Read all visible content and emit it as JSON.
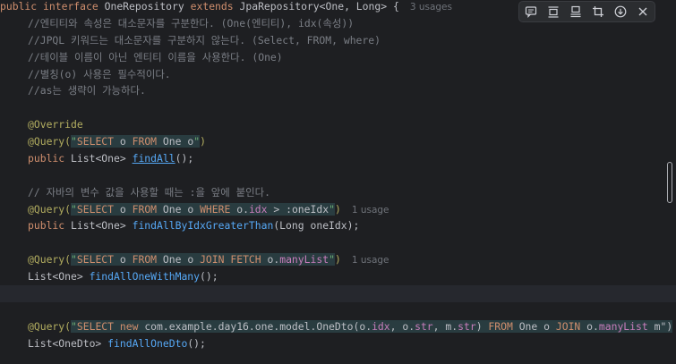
{
  "editor": {
    "header": {
      "public": "public",
      "interface": "interface",
      "name": "OneRepository",
      "extends": "extends",
      "parent": "JpaRepository<One, Long>",
      "brace": " {",
      "usages": "3 usages"
    },
    "comments": [
      "//엔티티와 속성은 대소문자를 구분한다. (One(엔티티), idx(속성))",
      "//JPQL 키워드는 대소문자를 구분하지 않는다. (Select, FROM, where)",
      "//테이블 이름이 아닌 엔티티 이름을 사용한다. (One)",
      "//별칭(o) 사용은 필수적이다.",
      "//as는 생략이 가능하다."
    ],
    "method1": {
      "override": "@Override",
      "query_ann": "@Query(",
      "q_open": "\"",
      "q_select": "SELECT",
      "q_o1": " o ",
      "q_from": "FROM",
      "q_one": " One o",
      "q_close": "\"",
      "paren_close": ")",
      "public": "public",
      "rtype": " List<One> ",
      "name": "findAll",
      "tail": "();"
    },
    "comment2": "// 자바의 변수 값을 사용할 때는 :을 앞에 붙인다.",
    "method2": {
      "query_ann": "@Query(",
      "q_open": "\"",
      "q_select": "SELECT",
      "q_o1": " o ",
      "q_from": "FROM",
      "q_one": " One o ",
      "q_where": "WHERE",
      "q_o2": " o.",
      "q_idx": "idx",
      "q_rest": " > :oneIdx",
      "q_close": "\"",
      "paren_close": ")",
      "usages": "1 usage",
      "public": "public",
      "rtype": " List<One> ",
      "name": "findAllByIdxGreaterThan",
      "tail": "(Long oneIdx);"
    },
    "method3": {
      "query_ann": "@Query(",
      "q_open": "\"",
      "q_select": "SELECT",
      "q_o1": " o ",
      "q_from": "FROM",
      "q_one": " One o ",
      "q_join": "JOIN FETCH",
      "q_o2": " o.",
      "q_many": "manyList",
      "q_close": "\"",
      "paren_close": ")",
      "usages": "1 usage",
      "rtype": "List<One> ",
      "name": "findAllOneWithMany",
      "tail": "();"
    },
    "method4": {
      "query_ann": "@Query(",
      "q_open": "\"",
      "q_select": "SELECT",
      "q_sp1": " ",
      "q_new": "new",
      "q_dto": " com.example.day16.one.model.OneDto(o.",
      "q_idx": "idx",
      "q_mid1": ", o.",
      "q_str1": "str",
      "q_mid2": ", m.",
      "q_str2": "str",
      "q_paren": ") ",
      "q_from": "FROM",
      "q_one": " One o ",
      "q_join": "JOIN",
      "q_o2": " o.",
      "q_many": "manyList",
      "q_m": " m\")",
      "rtype": "List<OneDto> ",
      "name": "findAllOneDto",
      "tail": "();"
    }
  },
  "toolbar": {
    "buttons": [
      "comment-icon",
      "align-icon",
      "panel-icon",
      "crop-icon",
      "download-icon",
      "close-icon"
    ]
  },
  "colors": {
    "background": "#1e1f22",
    "keyword": "#cf8e6d",
    "comment": "#7a7e85",
    "annotation": "#b3ae60",
    "function": "#56a8f5",
    "field": "#c77dbb",
    "string": "#6aab73",
    "sql_background": "#293c40"
  }
}
